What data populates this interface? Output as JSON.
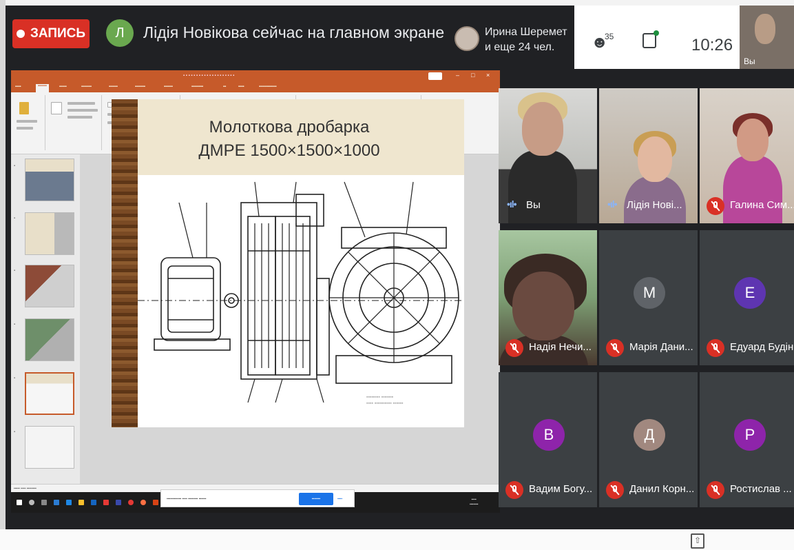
{
  "topbar": {
    "record_label": "ЗАПИСЬ",
    "presenter_initial": "Л",
    "presenter_text": "Лідія Новікова сейчас на главном экране",
    "viewers_line1": "Ирина Шеремет",
    "viewers_line2": "и еще 24 чел.",
    "participants_count": "35",
    "time": "10:26",
    "self_label": "Вы"
  },
  "presentation": {
    "slide_title_line1": "Молоткова дробарка",
    "slide_title_line2": "ДМРЕ 1500×1500×1000"
  },
  "participants": [
    {
      "name": "Вы",
      "type": "video",
      "state": "speaking"
    },
    {
      "name": "Лідія Нові...",
      "type": "video",
      "state": "speaking"
    },
    {
      "name": "Галина Сим...",
      "type": "video",
      "state": "muted"
    },
    {
      "name": "Надія Нечи...",
      "type": "video",
      "state": "muted"
    },
    {
      "name": "Марія Дани...",
      "type": "avatar",
      "initial": "М",
      "color": "#5f6368",
      "state": "muted"
    },
    {
      "name": "Едуард Будін",
      "type": "avatar",
      "initial": "Е",
      "color": "#5e35b1",
      "state": "muted"
    },
    {
      "name": "Вадим Богу...",
      "type": "avatar",
      "initial": "В",
      "color": "#8e24aa",
      "state": "muted"
    },
    {
      "name": "Данил Корн...",
      "type": "avatar",
      "initial": "Д",
      "color": "#a1887f",
      "state": "muted"
    },
    {
      "name": "Ростислав ...",
      "type": "avatar",
      "initial": "Р",
      "color": "#8e24aa",
      "state": "muted"
    }
  ],
  "colors": {
    "record": "#d93025",
    "presenter_avatar": "#6aa84f",
    "meet_bg": "#202124",
    "tile_bg": "#3c4043",
    "ppt_accent": "#c65a2a",
    "share_button": "#1a73e8"
  },
  "icons": [
    "record-dot-icon",
    "people-icon",
    "chat-icon",
    "mic-off-icon",
    "speaking-icon",
    "share-screen-icon"
  ]
}
